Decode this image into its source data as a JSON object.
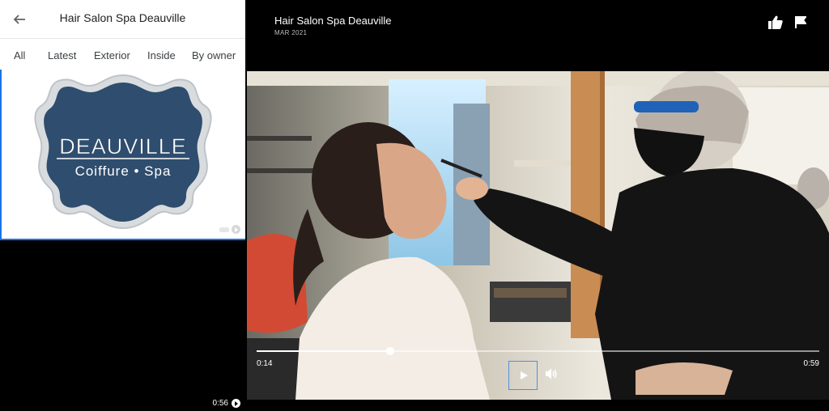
{
  "left_panel": {
    "title": "Hair Salon Spa Deauville",
    "tabs": [
      "All",
      "Latest",
      "Exterior",
      "Inside",
      "By owner"
    ],
    "logo": {
      "line1": "DEAUVILLE",
      "line2": "Coiffure • Spa"
    },
    "video_duration": "0:56"
  },
  "viewer": {
    "title": "Hair Salon Spa Deauville",
    "date": "MAR 2021",
    "current_time": "0:14",
    "total_time": "0:59",
    "progress": 0.2371
  },
  "colors": {
    "logo_fill": "#2f4d6e",
    "logo_border": "#c9cdd1",
    "selection": "#1a73e8"
  },
  "icons": {
    "back": "arrow-left-icon",
    "collapse": "chevron-left-icon",
    "like": "thumbs-up-icon",
    "report": "flag-icon",
    "play": "play-icon",
    "volume": "volume-icon"
  }
}
